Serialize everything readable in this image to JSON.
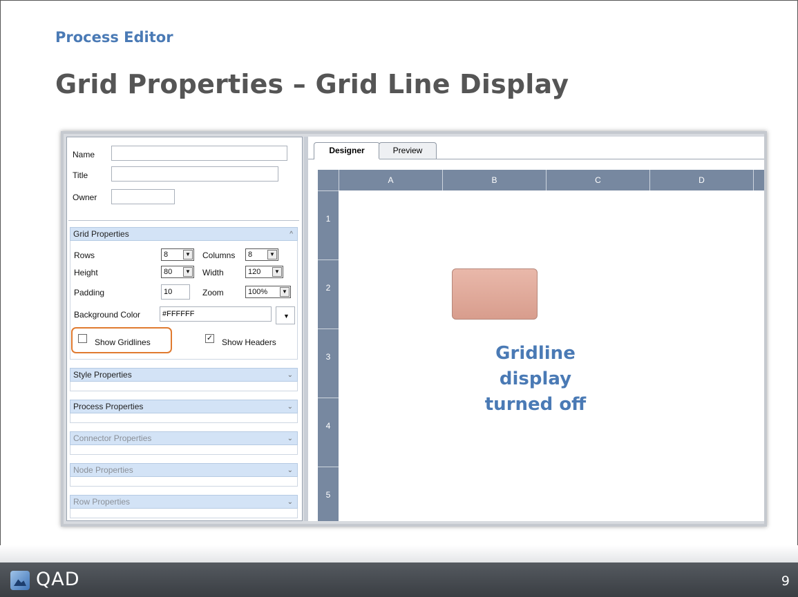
{
  "slide": {
    "section_title": "Process Editor",
    "title": "Grid Properties – Grid Line Display",
    "page_number": "9",
    "logo_text": "QAD"
  },
  "properties_panel": {
    "name_label": "Name",
    "name_value": "",
    "title_label": "Title",
    "title_value": "",
    "owner_label": "Owner",
    "owner_value": "",
    "grid_properties": {
      "header": "Grid Properties",
      "rows_label": "Rows",
      "rows_value": "8",
      "columns_label": "Columns",
      "columns_value": "8",
      "height_label": "Height",
      "height_value": "80",
      "width_label": "Width",
      "width_value": "120",
      "padding_label": "Padding",
      "padding_value": "10",
      "zoom_label": "Zoom",
      "zoom_value": "100%",
      "background_color_label": "Background Color",
      "background_color_value": "#FFFFFF",
      "show_gridlines_label": "Show Gridlines",
      "show_gridlines_checked": false,
      "show_headers_label": "Show Headers",
      "show_headers_checked": true
    },
    "sections": {
      "style": "Style Properties",
      "process": "Process Properties",
      "connector": "Connector Properties",
      "node": "Node Properties",
      "row": "Row Properties"
    }
  },
  "designer": {
    "tabs": [
      "Designer",
      "Preview"
    ],
    "active_tab": "Designer",
    "column_headers": [
      "A",
      "B",
      "C",
      "D"
    ],
    "row_headers": [
      "1",
      "2",
      "3",
      "4",
      "5"
    ],
    "caption_lines": [
      "Gridline",
      "display",
      "turned off"
    ]
  },
  "colors": {
    "accent_blue": "#4a7ab5",
    "title_gray": "#555555",
    "highlight_orange": "#e07a2f",
    "header_slate": "#7788a0",
    "node_fill": "#dba597"
  }
}
